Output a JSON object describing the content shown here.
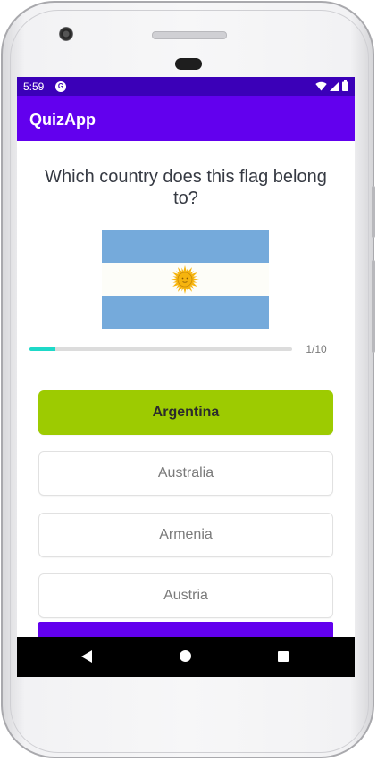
{
  "status_bar": {
    "time": "5:59",
    "app_icon_glyph": "G",
    "icons": [
      "wifi-icon",
      "signal-icon",
      "battery-icon"
    ]
  },
  "app_bar": {
    "title": "QuizApp"
  },
  "quiz": {
    "question": "Which country does this flag belong to?",
    "flag": {
      "country_shown": "Argentina",
      "colors": {
        "sky_blue": "#75aadb",
        "white": "#fdfdf8",
        "sun": "#f6b40e"
      }
    },
    "progress": {
      "current": 1,
      "total": 10,
      "fraction": 0.1,
      "text": "1/10"
    },
    "options": [
      {
        "label": "Argentina",
        "selected": true
      },
      {
        "label": "Australia",
        "selected": false
      },
      {
        "label": "Armenia",
        "selected": false
      },
      {
        "label": "Austria",
        "selected": false
      }
    ]
  },
  "colors": {
    "primary": "#6200ee",
    "primary_dark": "#3b00b8",
    "selected_option": "#9dcb01",
    "progress_fill": "#1ed9c8"
  }
}
